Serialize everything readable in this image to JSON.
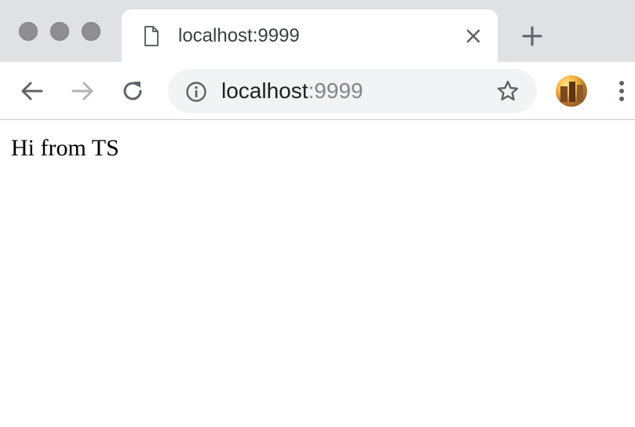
{
  "tab": {
    "title": "localhost:9999",
    "icons": {
      "page": "document-icon",
      "close": "close-icon",
      "new_tab": "plus-icon"
    }
  },
  "toolbar": {
    "icons": {
      "back": "arrow-left-icon",
      "forward": "arrow-right-icon",
      "reload": "reload-icon",
      "site_info": "info-icon",
      "bookmark": "star-icon",
      "menu": "kebab-menu-icon"
    },
    "url": {
      "host": "localhost",
      "port": ":9999"
    }
  },
  "page": {
    "text": "Hi from TS"
  },
  "colors": {
    "tabstrip_bg": "#dfe1e5",
    "omnibox_bg": "#f1f3f4",
    "url_host": "#202124",
    "url_port": "#80868b",
    "forward_disabled": "#b0b3b8"
  }
}
